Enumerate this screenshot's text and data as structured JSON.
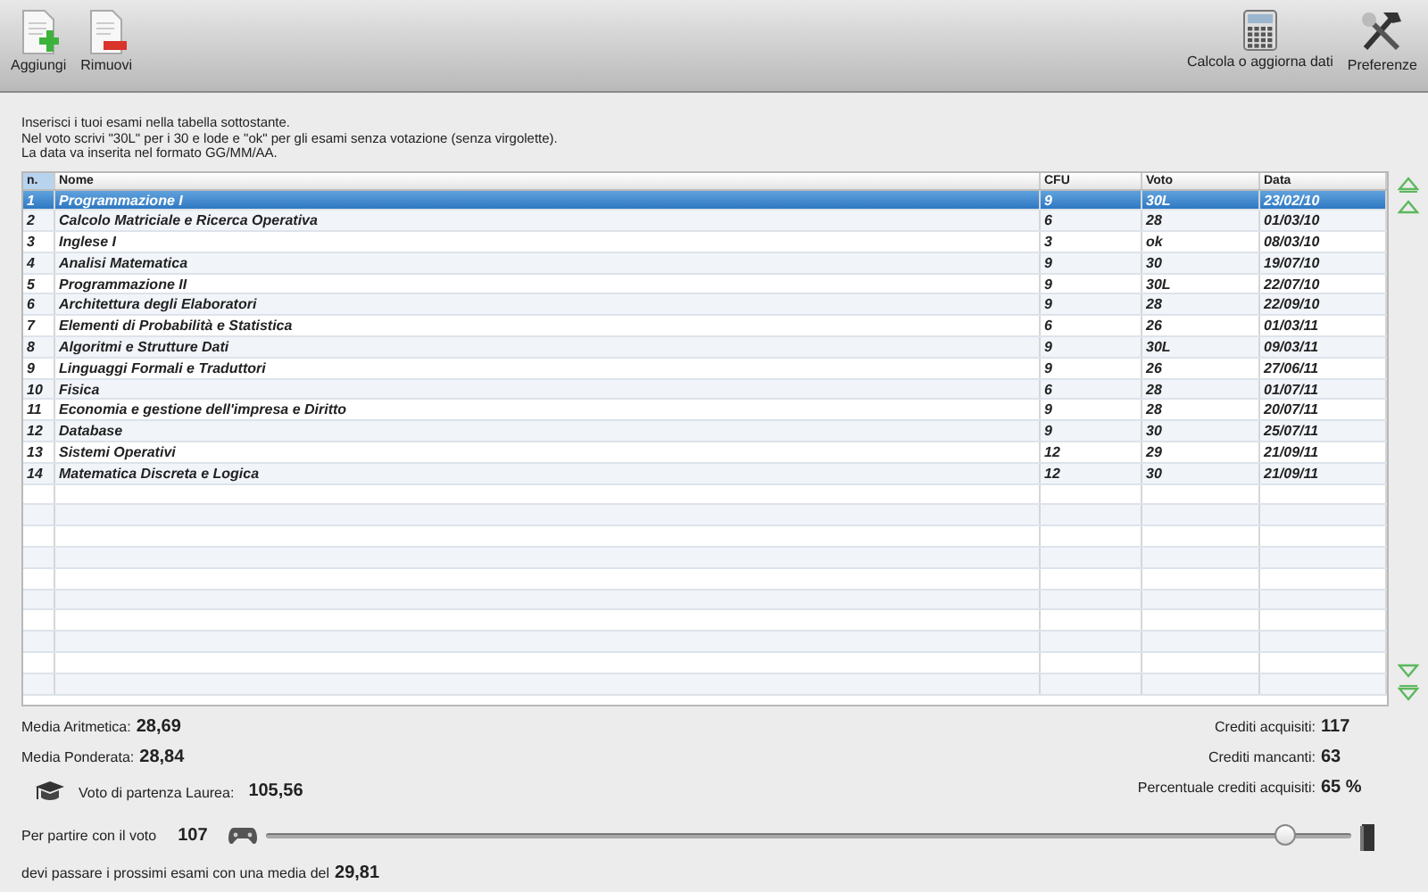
{
  "toolbar": {
    "left": [
      {
        "kind": "add",
        "label": "Aggiungi"
      },
      {
        "kind": "remove",
        "label": "Rimuovi"
      }
    ],
    "right": [
      {
        "kind": "calculator",
        "label": "Calcola o aggiorna dati"
      },
      {
        "kind": "tools",
        "label": "Preferenze"
      }
    ]
  },
  "instructions": [
    "Inserisci i tuoi esami nella tabella sottostante.",
    "Nel voto scrivi \"30L\" per i 30 e lode e \"ok\" per gli esami senza votazione (senza virgolette).",
    "La data va inserita nel formato GG/MM/AA."
  ],
  "table": {
    "columns": [
      "n.",
      "Nome",
      "CFU",
      "Voto",
      "Data"
    ],
    "rows": [
      {
        "selected": true,
        "cells": [
          "1",
          "Programmazione I",
          "9",
          "30L",
          "23/02/10"
        ]
      },
      {
        "selected": false,
        "cells": [
          "2",
          "Calcolo Matriciale e Ricerca Operativa",
          "6",
          "28",
          "01/03/10"
        ]
      },
      {
        "selected": false,
        "cells": [
          "3",
          "Inglese I",
          "3",
          "ok",
          "08/03/10"
        ]
      },
      {
        "selected": false,
        "cells": [
          "4",
          "Analisi Matematica",
          "9",
          "30",
          "19/07/10"
        ]
      },
      {
        "selected": false,
        "cells": [
          "5",
          "Programmazione II",
          "9",
          "30L",
          "22/07/10"
        ]
      },
      {
        "selected": false,
        "cells": [
          "6",
          "Architettura degli Elaboratori",
          "9",
          "28",
          "22/09/10"
        ]
      },
      {
        "selected": false,
        "cells": [
          "7",
          "Elementi di Probabilità e Statistica",
          "6",
          "26",
          "01/03/11"
        ]
      },
      {
        "selected": false,
        "cells": [
          "8",
          "Algoritmi e Strutture Dati",
          "9",
          "30L",
          "09/03/11"
        ]
      },
      {
        "selected": false,
        "cells": [
          "9",
          "Linguaggi Formali e Traduttori",
          "9",
          "26",
          "27/06/11"
        ]
      },
      {
        "selected": false,
        "cells": [
          "10",
          "Fisica",
          "6",
          "28",
          "01/07/11"
        ]
      },
      {
        "selected": false,
        "cells": [
          "11",
          "Economia e gestione dell'impresa e Diritto",
          "9",
          "28",
          "20/07/11"
        ]
      },
      {
        "selected": false,
        "cells": [
          "12",
          "Database",
          "9",
          "30",
          "25/07/11"
        ]
      },
      {
        "selected": false,
        "cells": [
          "13",
          "Sistemi Operativi",
          "12",
          "29",
          "21/09/11"
        ]
      },
      {
        "selected": false,
        "cells": [
          "14",
          "Matematica Discreta e Logica",
          "12",
          "30",
          "21/09/11"
        ]
      }
    ]
  },
  "stats_left": [
    {
      "label": "Media Aritmetica:",
      "value": "28,69"
    },
    {
      "label": "Media Ponderata:",
      "value": "28,84"
    }
  ],
  "stats_right": [
    {
      "label": "Crediti acquisiti:",
      "value": "117"
    },
    {
      "label": "Crediti mancanti:",
      "value": "63"
    },
    {
      "label": "Percentuale crediti acquisiti:",
      "value": "65 %"
    }
  ],
  "graduation": {
    "label": "Voto di partenza Laurea:",
    "value": "105,56"
  },
  "target": {
    "label": "Per partire con il voto",
    "value": "107",
    "level": 0.94,
    "result_label": "devi passare i prossimi esami con una media del",
    "result_value": "29,81"
  }
}
